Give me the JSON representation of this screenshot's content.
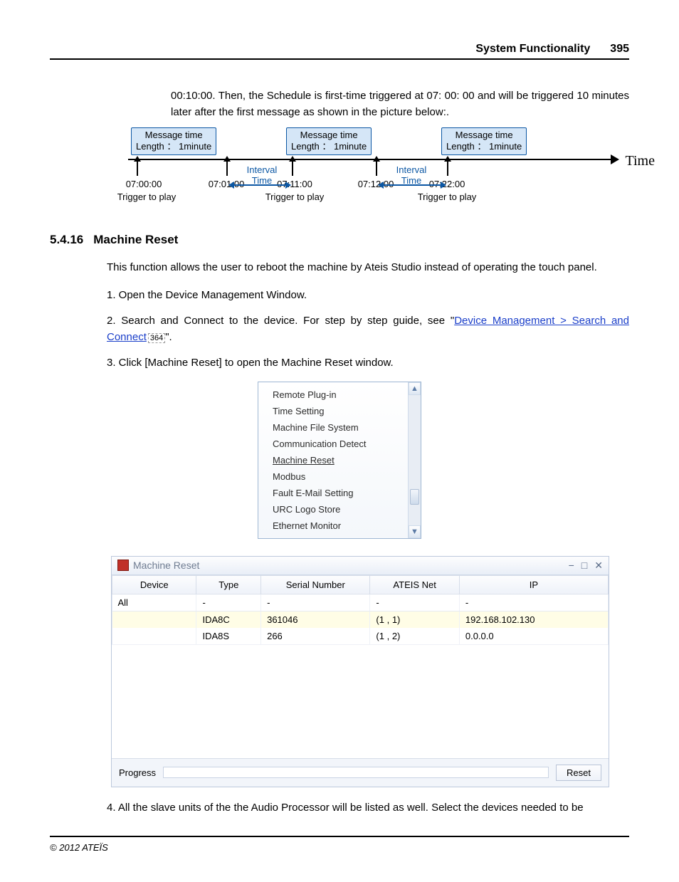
{
  "header": {
    "title": "System Functionality",
    "page": "395"
  },
  "intro": "00:10:00. Then, the Schedule is first-time triggered at 07: 00: 00 and will be triggered 10 minutes later after the first message as shown in the picture below:.",
  "timeline": {
    "msg_line1": "Message time",
    "msg_line2": "Length ： 1minute",
    "interval_label1": "Interval",
    "interval_label2": "Time",
    "time_axis_label": "Time",
    "ticks": [
      {
        "time": "07:00:00",
        "label": "Trigger to play"
      },
      {
        "time": "07:01:00",
        "label": ""
      },
      {
        "time": "07:11:00",
        "label": "Trigger to play"
      },
      {
        "time": "07:12:00",
        "label": ""
      },
      {
        "time": "07:22:00",
        "label": "Trigger to play"
      }
    ]
  },
  "section": {
    "number": "5.4.16",
    "title": "Machine Reset"
  },
  "body": {
    "desc": "This function allows the user to reboot the machine by Ateis Studio instead of operating the touch panel.",
    "step1": "1. Open the Device Management Window.",
    "step2_a": "2. Search and Connect to the device. For step by step guide, see \"",
    "step2_link": "Device Management > Search and Connect",
    "step2_ref": "364",
    "step2_b": "\".",
    "step3": "3. Click [Machine Reset] to open the Machine Reset window.",
    "step4": "4. All the slave units of the the Audio Processor will be listed as well. Select the devices needed to be"
  },
  "menu": {
    "items": [
      "Remote Plug-in",
      "Time Setting",
      "Machine File System",
      "Communication Detect",
      "Machine Reset",
      "Modbus",
      "Fault E-Mail Setting",
      "URC Logo Store",
      "Ethernet Monitor"
    ],
    "selected_index": 4
  },
  "mr_window": {
    "title": "Machine Reset",
    "columns": [
      "Device",
      "Type",
      "Serial Number",
      "ATEIS Net",
      "IP"
    ],
    "filter_row": [
      "All",
      "-",
      "-",
      "-",
      "-"
    ],
    "rows": [
      {
        "device": "",
        "type": "IDA8C",
        "serial": "361046",
        "net": "(1 , 1)",
        "ip": "192.168.102.130",
        "selected": true
      },
      {
        "device": "",
        "type": "IDA8S",
        "serial": "266",
        "net": "(1 , 2)",
        "ip": "0.0.0.0",
        "selected": false
      }
    ],
    "progress_label": "Progress",
    "reset_label": "Reset"
  },
  "footer": {
    "copyright": "© 2012 ATEÏS"
  }
}
